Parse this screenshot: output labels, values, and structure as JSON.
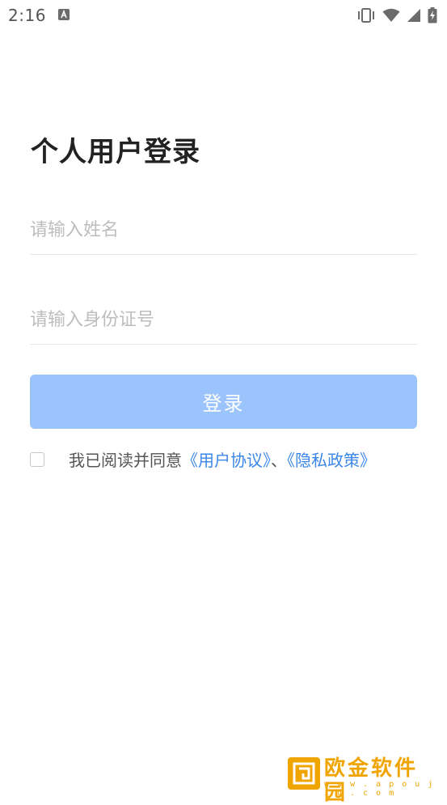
{
  "status_bar": {
    "time": "2:16",
    "notification_icon": "a-square-icon",
    "icons": [
      "vibrate-icon",
      "wifi-icon",
      "signal-icon",
      "battery-charging-icon"
    ]
  },
  "login": {
    "title": "个人用户登录",
    "name_placeholder": "请输入姓名",
    "name_value": "",
    "id_placeholder": "请输入身份证号",
    "id_value": "",
    "button_label": "登录",
    "button_color": "#9cc4fc"
  },
  "agreement": {
    "checked": false,
    "prefix": "我已阅读并同意",
    "user_agreement": "《用户协议》",
    "separator": "、",
    "privacy_policy": "《隐私政策》",
    "link_color": "#3b86e8"
  },
  "watermark": {
    "text": "欧金软件园",
    "url": "w w w . a p o u j i n . c o m",
    "color": "#f0a400"
  }
}
